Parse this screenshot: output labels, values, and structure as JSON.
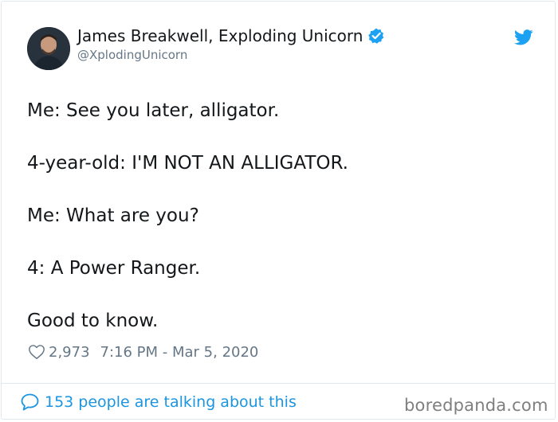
{
  "author": {
    "display_name": "James Breakwell, Exploding Unicorn",
    "handle": "@XplodingUnicorn",
    "verified": true
  },
  "tweet": {
    "lines": [
      "Me: See you later, alligator.",
      "4-year-old: I'M NOT AN ALLIGATOR.",
      "Me: What are you?",
      "4: A Power Ranger.",
      "Good to know."
    ],
    "likes": "2,973",
    "timestamp": "7:16 PM - Mar 5, 2020"
  },
  "footer": {
    "conversation_label": "153 people are talking about this",
    "watermark": "boredpanda.com"
  },
  "colors": {
    "twitter_blue": "#1da1f2",
    "link_blue": "#1b95e0",
    "secondary_text": "#657786",
    "border": "#e1e8ed"
  },
  "icons": {
    "verified": "verified-badge-icon",
    "brand": "twitter-bird-icon",
    "like": "heart-icon",
    "conversation": "speech-bubble-icon"
  }
}
